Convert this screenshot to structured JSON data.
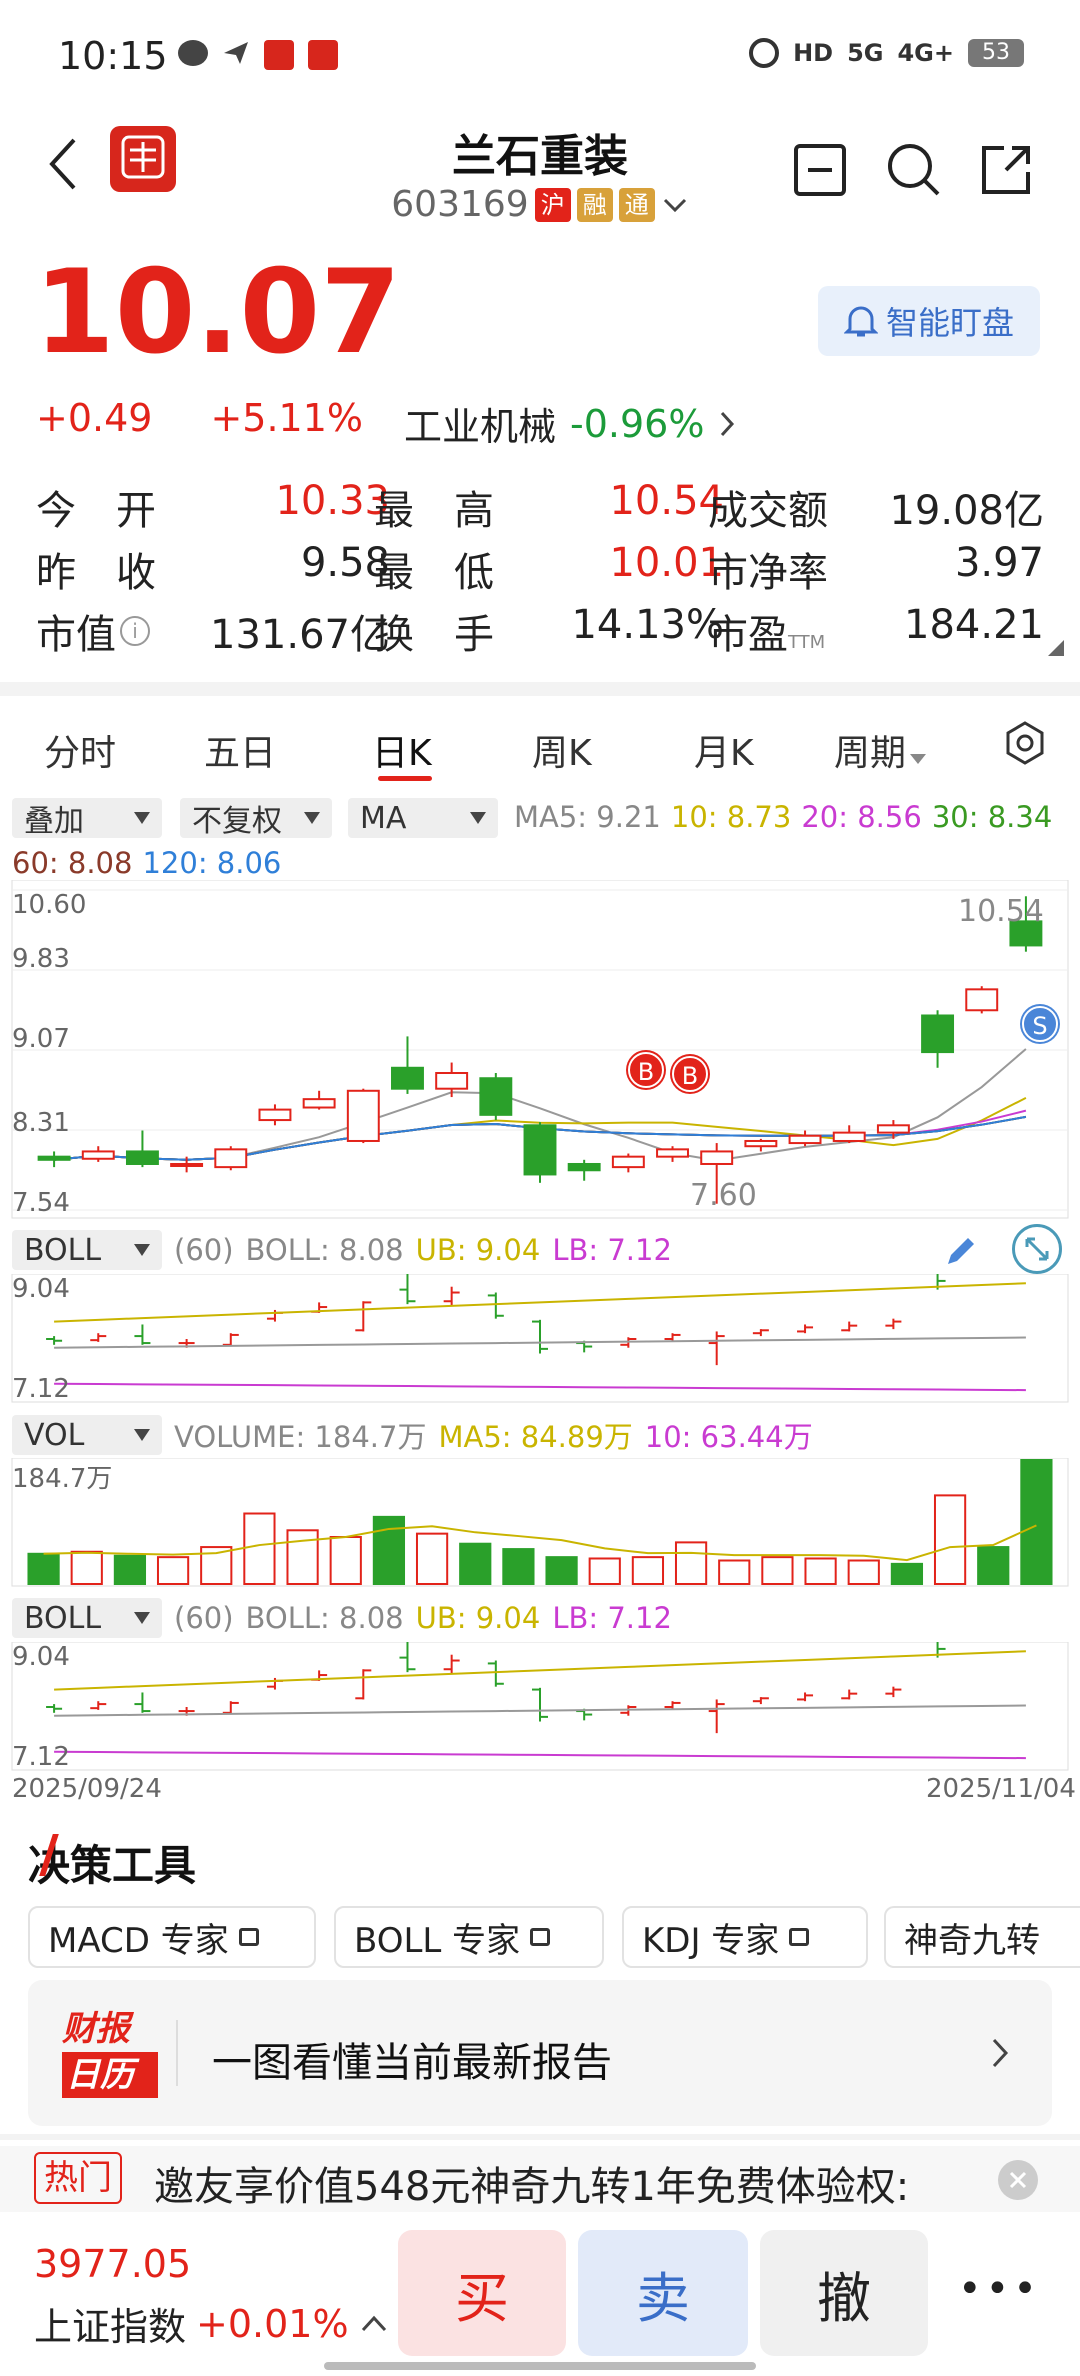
{
  "status_bar": {
    "time": "10:15",
    "battery": "53"
  },
  "header": {
    "title": "兰石重装",
    "code": "603169",
    "tags": [
      "沪",
      "融",
      "通"
    ]
  },
  "quote": {
    "price": "10.07",
    "change": "+0.49",
    "change_pct": "+5.11%",
    "alert_label": "智能盯盘",
    "industry": "工业机械",
    "industry_change": "-0.96%",
    "stats": [
      {
        "label": "今　开",
        "value": "10.33"
      },
      {
        "label": "最　高",
        "value": "10.54"
      },
      {
        "label": "成交额",
        "value": "19.08亿"
      },
      {
        "label": "昨　收",
        "value": "9.58"
      },
      {
        "label": "最　低",
        "value": "10.01"
      },
      {
        "label": "市净率",
        "value": "3.97"
      },
      {
        "label": "市值",
        "value": "131.67亿"
      },
      {
        "label": "换　手",
        "value": "14.13%"
      },
      {
        "label": "市盈",
        "value": "184.21"
      }
    ],
    "pe_suffix": "TTM"
  },
  "tabs": [
    "分时",
    "五日",
    "日K",
    "周K",
    "月K",
    "周期"
  ],
  "chart_controls": {
    "overlay": "叠加",
    "adjust": "不复权",
    "indicator": "MA"
  },
  "ma_legend": [
    {
      "text": "MA5: 9.21",
      "color": "#888888"
    },
    {
      "text": "10: 8.73",
      "color": "#c9b400"
    },
    {
      "text": "20: 8.56",
      "color": "#c93bd1"
    },
    {
      "text": "30: 8.34",
      "color": "#3a9a22"
    },
    {
      "text": "60: 8.08",
      "color": "#8a3a2a"
    },
    {
      "text": "120: 8.06",
      "color": "#2f7fd8"
    }
  ],
  "price_axis": [
    "10.60",
    "9.83",
    "9.07",
    "8.31",
    "7.54"
  ],
  "price_annotations": {
    "high": "10.54",
    "low": "7.60",
    "buy_marker": "B",
    "sell_marker": "S"
  },
  "boll": {
    "name": "BOLL",
    "param": "(60)",
    "boll": "BOLL: 8.08",
    "ub": "UB: 9.04",
    "lb": "LB: 7.12",
    "axis_top": "9.04",
    "axis_bottom": "7.12"
  },
  "vol": {
    "name": "VOL",
    "volume": "VOLUME: 184.7万",
    "ma5": "MA5: 84.89万",
    "ma10": "10: 63.44万",
    "axis_top": "184.7万"
  },
  "dates": {
    "start": "2025/09/24",
    "end": "2025/11/04"
  },
  "tools_section": {
    "title": "决策工具",
    "chips": [
      "MACD 专家",
      "BOLL 专家",
      "KDJ 专家",
      "神奇九转"
    ]
  },
  "report_card": {
    "logo_top": "财报",
    "logo_bottom": "日历",
    "text": "一图看懂当前最新报告"
  },
  "hot": {
    "tag": "热门",
    "text": "邀友享价值548元神奇九转1年免费体验权:"
  },
  "bottom": {
    "index_value": "3977.05",
    "index_name": "上证指数",
    "index_change": "+0.01%",
    "buy": "买",
    "sell": "卖",
    "cancel": "撤",
    "more": "•••"
  },
  "chart_data": {
    "type": "candlestick",
    "ylim": [
      7.54,
      10.6
    ],
    "candles": [
      {
        "o": 8.05,
        "c": 8.02,
        "h": 8.1,
        "l": 7.95
      },
      {
        "o": 8.03,
        "c": 8.1,
        "h": 8.15,
        "l": 8.0
      },
      {
        "o": 8.1,
        "c": 7.98,
        "h": 8.3,
        "l": 7.95
      },
      {
        "o": 7.98,
        "c": 7.98,
        "h": 8.05,
        "l": 7.9
      },
      {
        "o": 7.95,
        "c": 8.12,
        "h": 8.15,
        "l": 7.92
      },
      {
        "o": 8.4,
        "c": 8.5,
        "h": 8.55,
        "l": 8.35
      },
      {
        "o": 8.52,
        "c": 8.6,
        "h": 8.68,
        "l": 8.5
      },
      {
        "o": 8.2,
        "c": 8.68,
        "h": 8.7,
        "l": 8.18
      },
      {
        "o": 8.9,
        "c": 8.7,
        "h": 9.2,
        "l": 8.65
      },
      {
        "o": 8.7,
        "c": 8.85,
        "h": 8.95,
        "l": 8.62
      },
      {
        "o": 8.8,
        "c": 8.45,
        "h": 8.85,
        "l": 8.4
      },
      {
        "o": 8.35,
        "c": 7.88,
        "h": 8.38,
        "l": 7.8
      },
      {
        "o": 7.98,
        "c": 7.92,
        "h": 8.02,
        "l": 7.82
      },
      {
        "o": 7.95,
        "c": 8.05,
        "h": 8.08,
        "l": 7.9
      },
      {
        "o": 8.05,
        "c": 8.12,
        "h": 8.15,
        "l": 8.0
      },
      {
        "o": 7.98,
        "c": 8.1,
        "h": 8.18,
        "l": 7.6
      },
      {
        "o": 8.15,
        "c": 8.2,
        "h": 8.22,
        "l": 8.1
      },
      {
        "o": 8.18,
        "c": 8.25,
        "h": 8.3,
        "l": 8.15
      },
      {
        "o": 8.2,
        "c": 8.28,
        "h": 8.35,
        "l": 8.18
      },
      {
        "o": 8.28,
        "c": 8.35,
        "h": 8.4,
        "l": 8.22
      },
      {
        "o": 9.4,
        "c": 9.05,
        "h": 9.45,
        "l": 8.9
      },
      {
        "o": 9.45,
        "c": 9.65,
        "h": 9.68,
        "l": 9.42
      },
      {
        "o": 10.3,
        "c": 10.07,
        "h": 10.54,
        "l": 10.01
      }
    ],
    "volumes": [
      45,
      48,
      42,
      40,
      55,
      105,
      80,
      70,
      100,
      75,
      60,
      52,
      40,
      38,
      40,
      62,
      35,
      40,
      38,
      35,
      30,
      132,
      55,
      184.7
    ]
  }
}
